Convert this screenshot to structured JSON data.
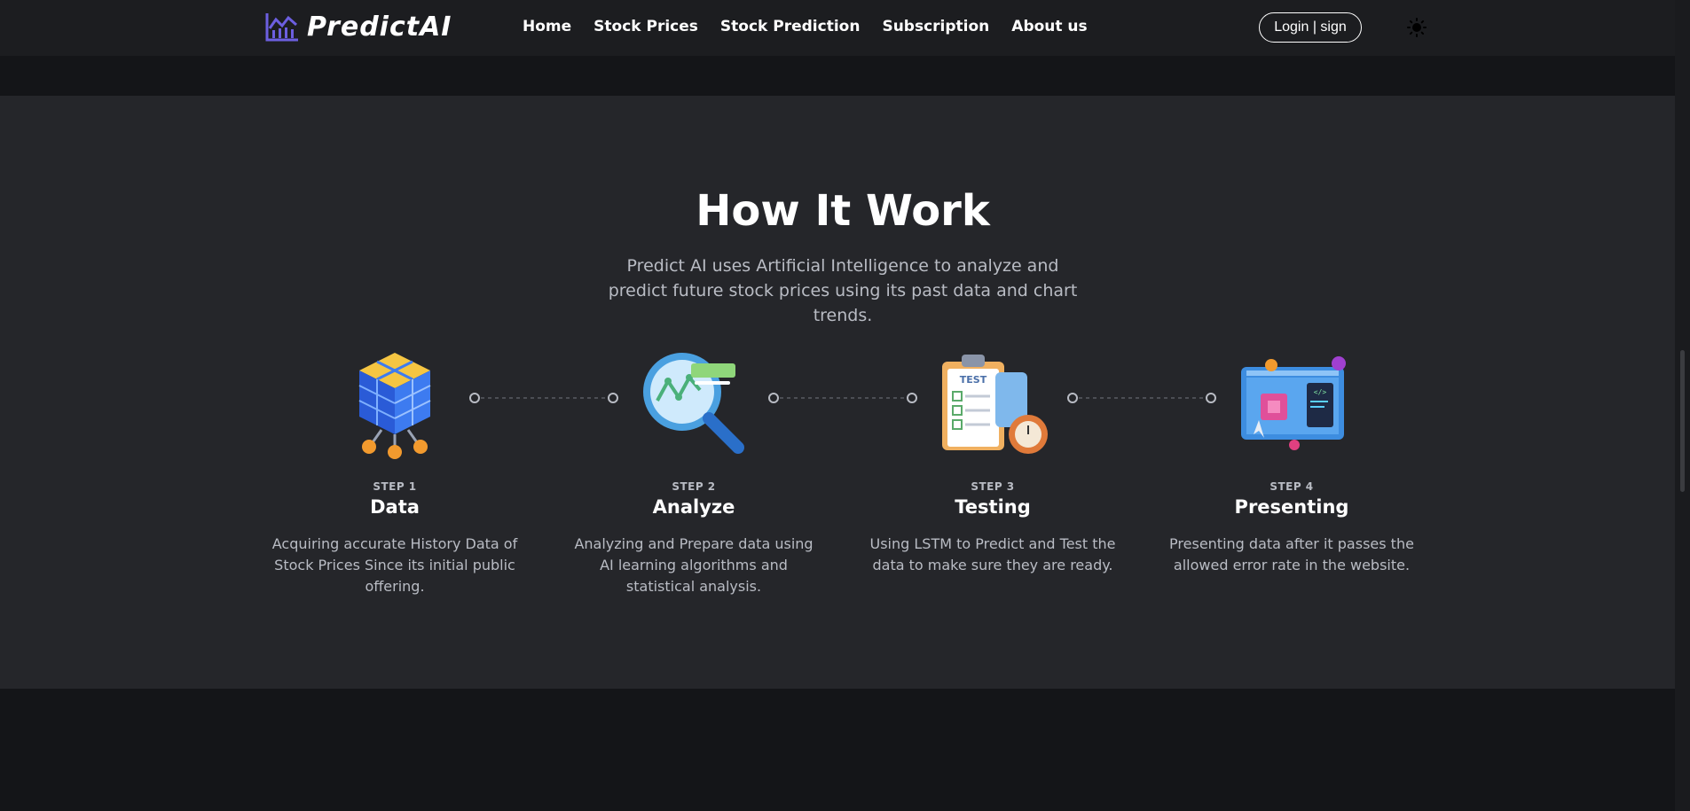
{
  "navbar": {
    "brand": "PredictAI",
    "links": [
      "Home",
      "Stock Prices",
      "Stock Prediction",
      "Subscription",
      "About us"
    ],
    "login_label": "Login | sign"
  },
  "section": {
    "title": "How It Work",
    "subtitle": "Predict AI uses Artificial Intelligence to analyze and predict future stock prices using its past data and chart trends."
  },
  "steps": [
    {
      "label": "STEP 1",
      "title": "Data",
      "desc": "Acquiring accurate History Data of Stock Prices Since its initial public offering.",
      "icon": "data-cube-icon"
    },
    {
      "label": "STEP 2",
      "title": "Analyze",
      "desc": "Analyzing and Prepare data using AI learning algorithms and statistical analysis.",
      "icon": "magnifier-chart-icon"
    },
    {
      "label": "STEP 3",
      "title": "Testing",
      "desc": "Using LSTM to Predict and Test the data to make sure they are ready.",
      "icon": "test-clipboard-icon"
    },
    {
      "label": "STEP 4",
      "title": "Presenting",
      "desc": "Presenting data after it passes the allowed error rate in the website.",
      "icon": "presentation-screen-icon"
    }
  ],
  "colors": {
    "background": "#141518",
    "navbar": "#1c1d20",
    "section": "#25262a",
    "muted_text": "#b9bcc4",
    "logo_accent": "#6c5fe0"
  }
}
